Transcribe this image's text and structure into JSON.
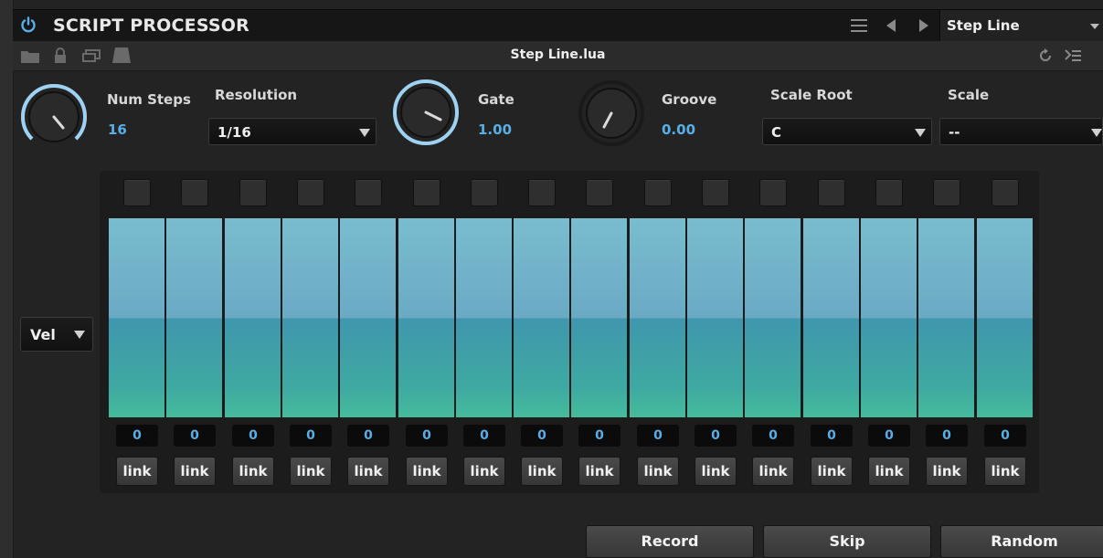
{
  "header": {
    "title": "SCRIPT PROCESSOR",
    "preset": "Step Line"
  },
  "toolbar": {
    "filename": "Step Line.lua"
  },
  "controls": {
    "num_steps": {
      "label": "Num Steps",
      "value": "16"
    },
    "resolution": {
      "label": "Resolution",
      "value": "1/16"
    },
    "gate": {
      "label": "Gate",
      "value": "1.00"
    },
    "groove": {
      "label": "Groove",
      "value": "0.00"
    },
    "scale_root": {
      "label": "Scale Root",
      "value": "C"
    },
    "scale": {
      "label": "Scale",
      "value": "--"
    }
  },
  "sequencer": {
    "mode": "Vel",
    "steps": [
      {
        "value": "0",
        "link": "link",
        "level": 0.5
      },
      {
        "value": "0",
        "link": "link",
        "level": 0.5
      },
      {
        "value": "0",
        "link": "link",
        "level": 0.5
      },
      {
        "value": "0",
        "link": "link",
        "level": 0.5
      },
      {
        "value": "0",
        "link": "link",
        "level": 0.5
      },
      {
        "value": "0",
        "link": "link",
        "level": 0.5
      },
      {
        "value": "0",
        "link": "link",
        "level": 0.5
      },
      {
        "value": "0",
        "link": "link",
        "level": 0.5
      },
      {
        "value": "0",
        "link": "link",
        "level": 0.5
      },
      {
        "value": "0",
        "link": "link",
        "level": 0.5
      },
      {
        "value": "0",
        "link": "link",
        "level": 0.5
      },
      {
        "value": "0",
        "link": "link",
        "level": 0.5
      },
      {
        "value": "0",
        "link": "link",
        "level": 0.5
      },
      {
        "value": "0",
        "link": "link",
        "level": 0.5
      },
      {
        "value": "0",
        "link": "link",
        "level": 0.5
      },
      {
        "value": "0",
        "link": "link",
        "level": 0.5
      }
    ]
  },
  "actions": {
    "record": "Record",
    "skip": "Skip",
    "random": "Random"
  },
  "colors": {
    "accent": "#5aaee6",
    "bar_top": "#7abccf",
    "bar_bottom": "#45bb9c"
  }
}
